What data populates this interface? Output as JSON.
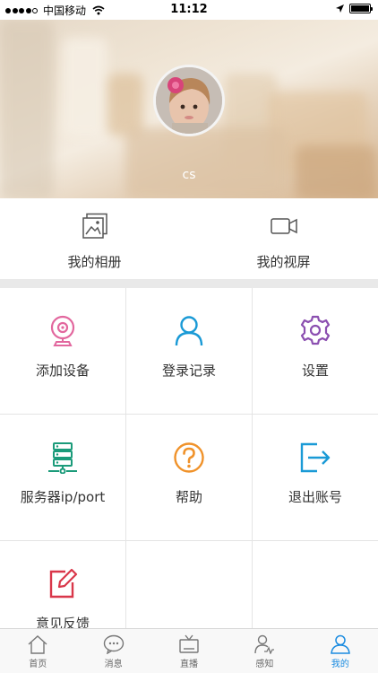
{
  "status_bar": {
    "carrier": "中国移动",
    "time": "11:12"
  },
  "profile": {
    "username": "cs"
  },
  "albums": [
    {
      "label": "我的相册",
      "icon": "photo-album-icon"
    },
    {
      "label": "我的视屏",
      "icon": "video-camera-icon"
    }
  ],
  "grid": [
    {
      "label": "添加设备",
      "icon": "webcam-icon",
      "color": "#e2679e"
    },
    {
      "label": "登录记录",
      "icon": "user-icon",
      "color": "#1a9ad6"
    },
    {
      "label": "设置",
      "icon": "gear-icon",
      "color": "#8b4fb0"
    },
    {
      "label": "服务器ip/port",
      "icon": "server-icon",
      "color": "#1b9b7a"
    },
    {
      "label": "帮助",
      "icon": "help-icon",
      "color": "#f0922a"
    },
    {
      "label": "退出账号",
      "icon": "logout-icon",
      "color": "#1a9ad6"
    },
    {
      "label": "意见反馈",
      "icon": "feedback-icon",
      "color": "#d9374a"
    }
  ],
  "tabs": [
    {
      "label": "首页",
      "icon": "home-icon"
    },
    {
      "label": "消息",
      "icon": "message-icon"
    },
    {
      "label": "直播",
      "icon": "tv-icon"
    },
    {
      "label": "感知",
      "icon": "sense-icon"
    },
    {
      "label": "我的",
      "icon": "profile-icon",
      "active": true
    }
  ],
  "colors": {
    "accent": "#1a8be0",
    "background": "#ffffff",
    "divider": "#e9e9e9"
  }
}
